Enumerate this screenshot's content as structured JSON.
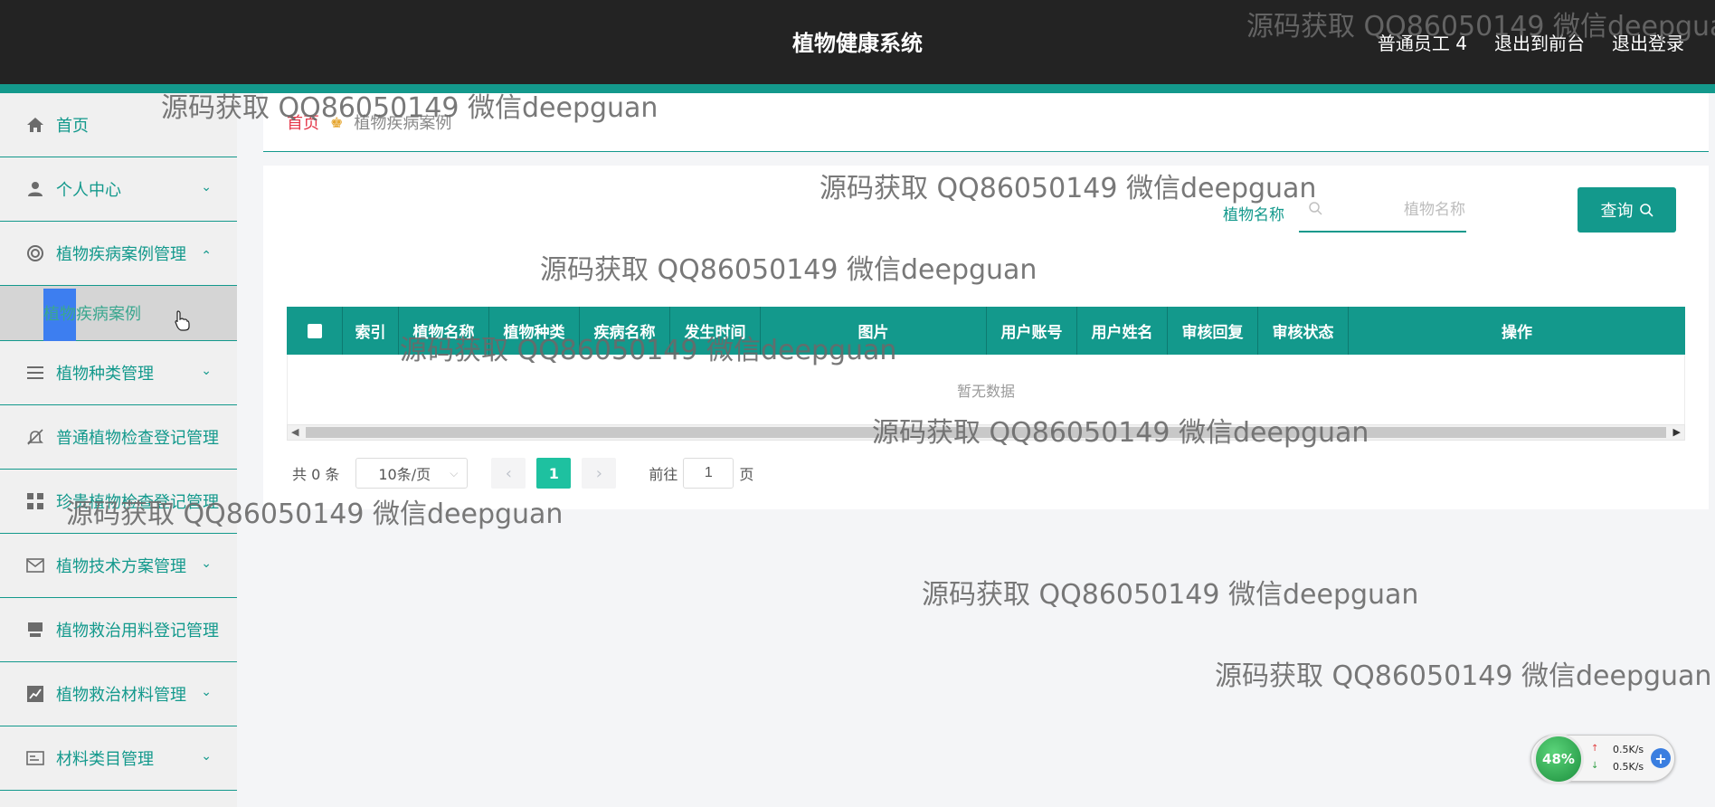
{
  "header": {
    "title": "植物健康系统",
    "links": [
      "普通员工 4",
      "退出到前台",
      "退出登录"
    ]
  },
  "sidebar": {
    "items": [
      {
        "label": "首页",
        "icon": "home-icon",
        "arrow": ""
      },
      {
        "label": "个人中心",
        "icon": "user-icon",
        "arrow": "⌄"
      },
      {
        "label": "植物疾病案例管理",
        "icon": "lifebuoy-icon",
        "arrow": "⌃"
      },
      {
        "label": "植物种类管理",
        "icon": "list-icon",
        "arrow": "⌄"
      },
      {
        "label": "普通植物检查登记管理",
        "icon": "bell-off-icon",
        "arrow": ""
      },
      {
        "label": "珍贵植物检查登记管理",
        "icon": "grid-icon",
        "arrow": ""
      },
      {
        "label": "植物技术方案管理",
        "icon": "mail-icon",
        "arrow": "⌄"
      },
      {
        "label": "植物救治用料登记管理",
        "icon": "box-icon",
        "arrow": ""
      },
      {
        "label": "植物救治材料管理",
        "icon": "chart-icon",
        "arrow": "⌄"
      },
      {
        "label": "材料类目管理",
        "icon": "card-icon",
        "arrow": "⌄"
      }
    ],
    "sub_item": "植物疾病案例"
  },
  "breadcrumb": {
    "home": "首页",
    "current": "植物疾病案例"
  },
  "search": {
    "label": "植物名称",
    "placeholder": "植物名称",
    "button": "查询"
  },
  "table": {
    "columns": [
      "索引",
      "植物名称",
      "植物种类",
      "疾病名称",
      "发生时间",
      "图片",
      "用户账号",
      "用户姓名",
      "审核回复",
      "审核状态",
      "操作"
    ],
    "empty_text": "暂无数据"
  },
  "pagination": {
    "total": "共 0 条",
    "page_size": "10条/页",
    "current_page": "1",
    "goto_prefix": "前往",
    "goto_value": "1",
    "goto_suffix": "页"
  },
  "watermark": "源码获取 QQ86050149 微信deepguan",
  "net_widget": {
    "percent": "48%",
    "up": "0.5K/s",
    "down": "0.5K/s"
  },
  "colors": {
    "accent": "#13998c",
    "header_bg": "#232323",
    "page_active": "#1ec1a0"
  }
}
